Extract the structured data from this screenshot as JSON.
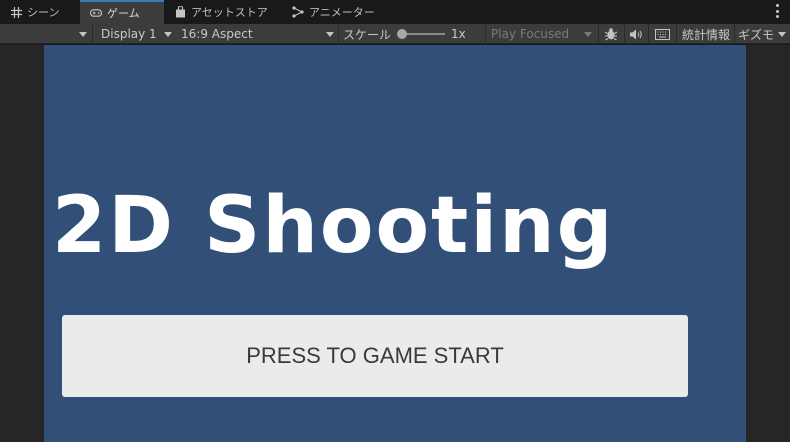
{
  "tabs": [
    {
      "label": "シーン",
      "icon": "grid-icon"
    },
    {
      "label": "ゲーム",
      "icon": "gamepad-icon",
      "active": true
    },
    {
      "label": "アセットストア",
      "icon": "bag-icon"
    },
    {
      "label": "アニメーター",
      "icon": "animator-icon"
    }
  ],
  "toolbar": {
    "display": "Display 1",
    "aspect": "16:9 Aspect",
    "scale_label": "スケール",
    "scale_value": "1x",
    "scale_fraction": 0.0,
    "play_mode": "Play Focused",
    "stats_label": "統計情報",
    "gizmos_label": "ギズモ"
  },
  "game": {
    "title": "2D Shooting",
    "start_button": "PRESS TO GAME START",
    "background_color": "#325077"
  },
  "colors": {
    "active_tab_accent": "#3a79bb",
    "toolbar": "#3c3c3c",
    "button": "#ebebeb"
  }
}
